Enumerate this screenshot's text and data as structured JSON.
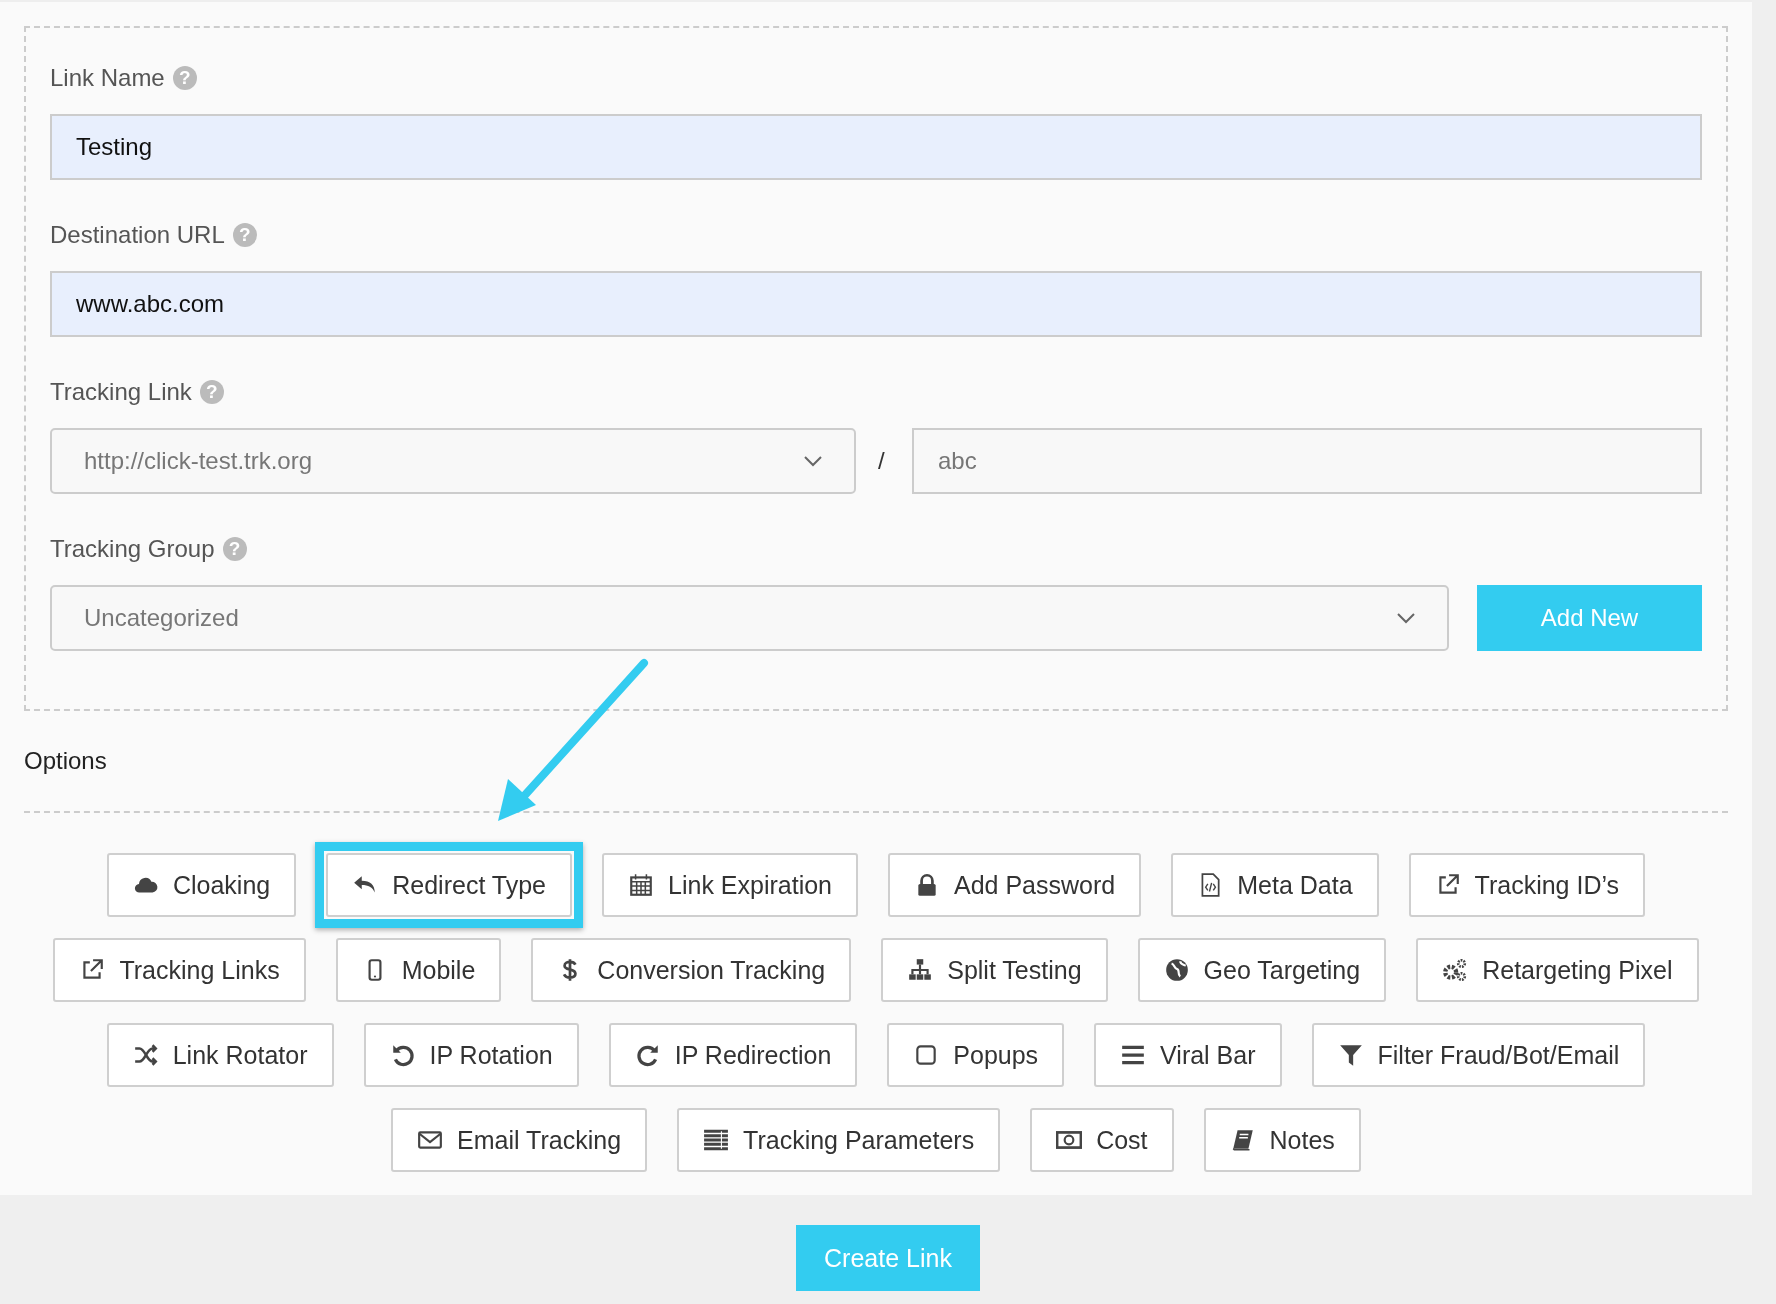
{
  "fields": [
    {
      "kind": "text",
      "label": "Link Name",
      "help": "?",
      "value": "Testing"
    },
    {
      "kind": "text",
      "label": "Destination URL",
      "help": "?",
      "value": "www.abc.com"
    },
    {
      "kind": "split",
      "label": "Tracking Link",
      "help": "?",
      "value": "http://click-test.trk.org",
      "separator": "/",
      "value_2": "abc"
    },
    {
      "kind": "select_add",
      "label": "Tracking Group",
      "help": "?",
      "value": "Uncategorized",
      "button": "Add New"
    }
  ],
  "options_title": "Options",
  "option_rows": [
    [
      {
        "label": "Cloaking",
        "highlighted": false
      },
      {
        "label": "Redirect Type",
        "highlighted": true
      },
      {
        "label": "Link Expiration",
        "highlighted": false
      },
      {
        "label": "Add Password",
        "highlighted": false
      },
      {
        "label": "Meta Data",
        "highlighted": false
      },
      {
        "label": "Tracking ID’s",
        "highlighted": false
      }
    ],
    [
      {
        "label": "Tracking Links",
        "highlighted": false
      },
      {
        "label": "Mobile",
        "highlighted": false
      },
      {
        "label": "Conversion Tracking",
        "highlighted": false
      },
      {
        "label": "Split Testing",
        "highlighted": false
      },
      {
        "label": "Geo Targeting",
        "highlighted": false
      },
      {
        "label": "Retargeting Pixel",
        "highlighted": false
      }
    ],
    [
      {
        "label": "Link Rotator",
        "highlighted": false
      },
      {
        "label": "IP Rotation",
        "highlighted": false
      },
      {
        "label": "IP Redirection",
        "highlighted": false
      },
      {
        "label": "Popups",
        "highlighted": false
      },
      {
        "label": "Viral Bar",
        "highlighted": false
      },
      {
        "label": "Filter Fraud/Bot/Email",
        "highlighted": false
      }
    ],
    [
      {
        "label": "Email Tracking",
        "highlighted": false
      },
      {
        "label": "Tracking Parameters",
        "highlighted": false
      },
      {
        "label": "Cost",
        "highlighted": false
      },
      {
        "label": "Notes",
        "highlighted": false
      }
    ]
  ],
  "submit": "Create Link"
}
